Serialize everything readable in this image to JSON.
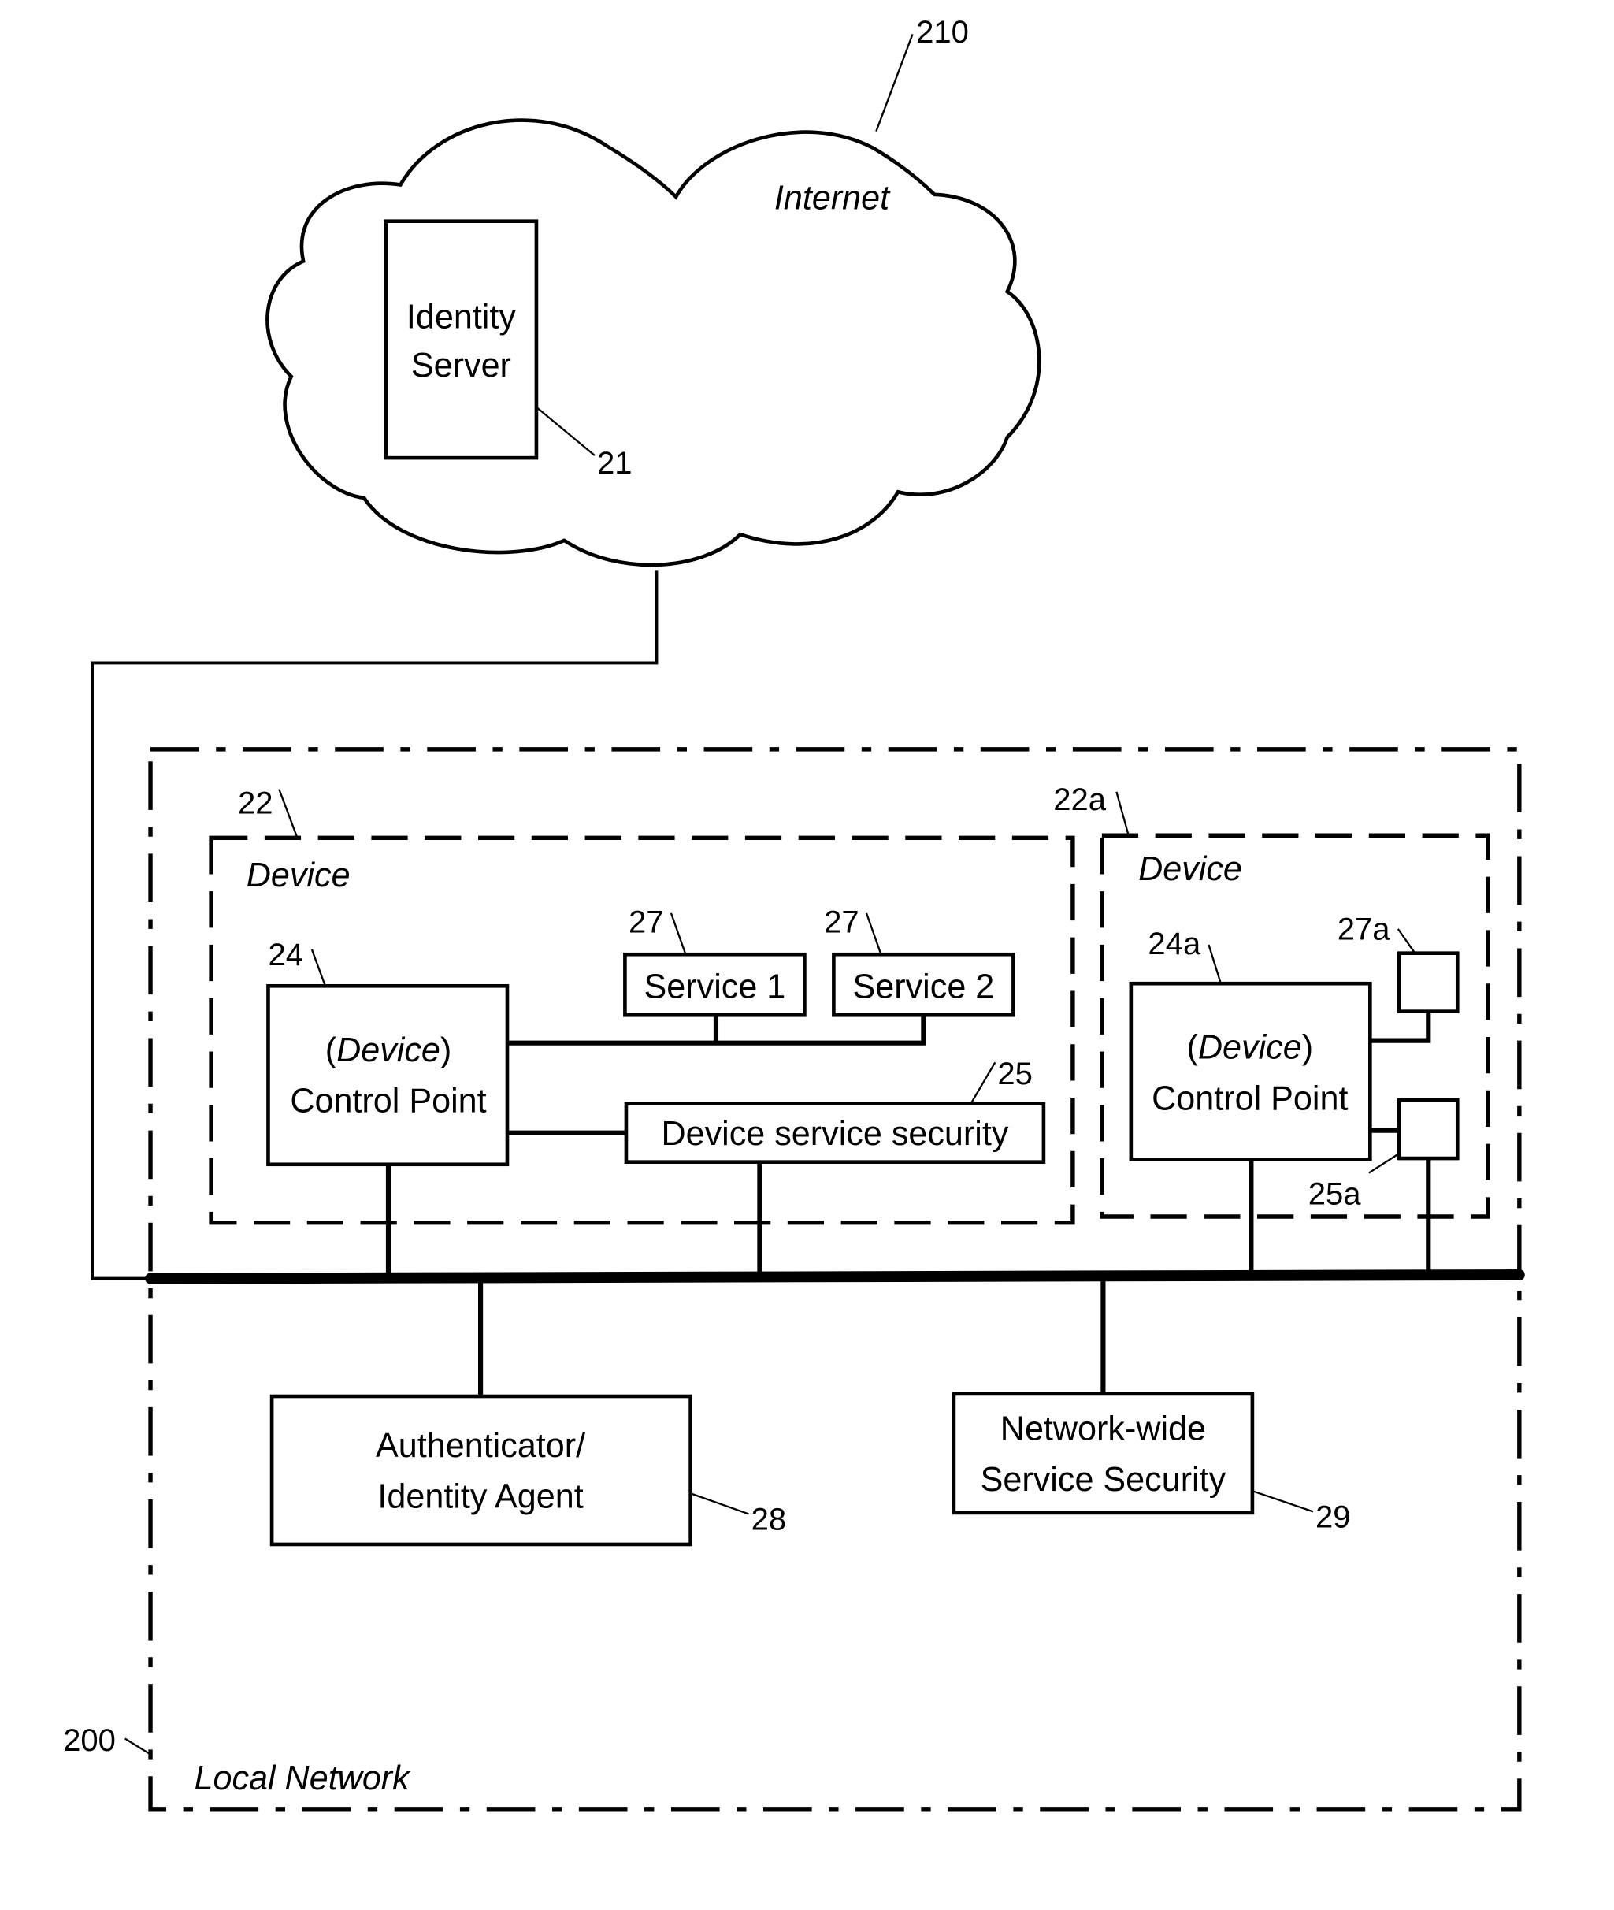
{
  "internet": {
    "label": "Internet",
    "ref": "210"
  },
  "identity_server": {
    "line1": "Identity",
    "line2": "Server",
    "ref": "21"
  },
  "local_network": {
    "label": "Local Network",
    "ref": "200"
  },
  "device_22": {
    "label": "Device",
    "ref": "22",
    "control_point": {
      "line1_open": "(",
      "line1_italic": "Device",
      "line1_close": ")",
      "line2": "Control Point",
      "ref": "24"
    },
    "service1": {
      "label": "Service 1",
      "ref": "27"
    },
    "service2": {
      "label": "Service 2",
      "ref": "27"
    },
    "security": {
      "label": "Device service security",
      "ref": "25"
    }
  },
  "device_22a": {
    "label": "Device",
    "ref": "22a",
    "control_point": {
      "line1_open": "(",
      "line1_italic": "Device",
      "line1_close": ")",
      "line2": "Control Point",
      "ref": "24a"
    },
    "service_ref": "27a",
    "security_ref": "25a"
  },
  "authenticator": {
    "line1": "Authenticator/",
    "line2": "Identity Agent",
    "ref": "28"
  },
  "network_security": {
    "line1": "Network-wide",
    "line2": "Service Security",
    "ref": "29"
  }
}
